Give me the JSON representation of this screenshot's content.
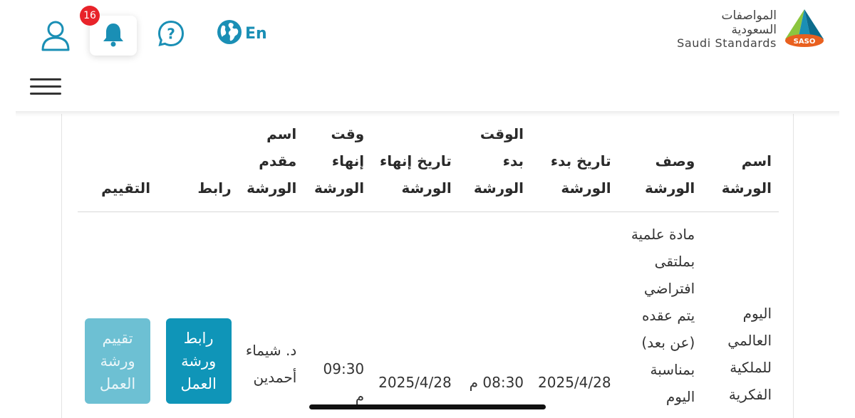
{
  "header": {
    "notification_count": "16",
    "language_label": "En",
    "logo": {
      "arabic_name": "المواصفات السعودية",
      "english_name": "Saudi Standards",
      "seal_text": "SASO"
    }
  },
  "table": {
    "columns": {
      "name": "اسم الورشة",
      "description": "وصف الورشة",
      "start_date": "تاريخ بدء الورشة",
      "start_time": "الوقت بدء الورشة",
      "end_date": "تاريخ إنهاء الورشة",
      "end_time": "وقت إنهاء الورشة",
      "presenter": "اسم مقدم الورشة",
      "link": "رابط",
      "rating": "التقييم"
    },
    "rows": [
      {
        "name": "اليوم العالمي للملكية الفكرية",
        "description": "مادة علمية بملتقى افتراضي يتم عقده (عن بعد) بمناسبة اليوم",
        "start_date": "2025/4/28",
        "start_time": "08:30 م",
        "end_date": "2025/4/28",
        "end_time": "09:30 م",
        "presenter": "د. شيماء أحمدين",
        "link_button": "رابط ورشة العمل",
        "rating_button": "تقييم ورشة العمل"
      }
    ]
  },
  "colors": {
    "accent": "#1a8fb5",
    "link_button": "#0f95b8",
    "rating_button": "#6dc0d3",
    "badge": "#e8232a"
  }
}
